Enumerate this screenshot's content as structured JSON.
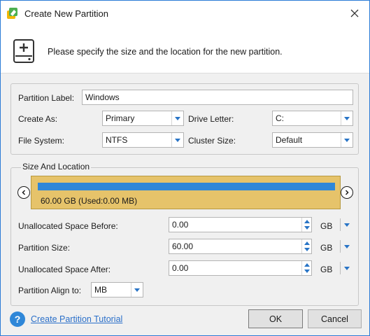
{
  "window": {
    "title": "Create New Partition"
  },
  "header": {
    "text": "Please specify the size and the location for the new partition."
  },
  "partition": {
    "label_caption": "Partition Label:",
    "label_value": "Windows",
    "create_as_caption": "Create As:",
    "create_as_value": "Primary",
    "drive_letter_caption": "Drive Letter:",
    "drive_letter_value": "C:",
    "file_system_caption": "File System:",
    "file_system_value": "NTFS",
    "cluster_size_caption": "Cluster Size:",
    "cluster_size_value": "Default"
  },
  "size_location": {
    "group_title": "Size And Location",
    "bar_text": "60.00 GB (Used:0.00 MB)",
    "before_caption": "Unallocated Space Before:",
    "before_value": "0.00",
    "before_unit": "GB",
    "size_caption": "Partition Size:",
    "size_value": "60.00",
    "size_unit": "GB",
    "after_caption": "Unallocated Space After:",
    "after_value": "0.00",
    "after_unit": "GB",
    "align_caption": "Partition Align to:",
    "align_value": "MB"
  },
  "footer": {
    "help_glyph": "?",
    "tutorial_link": "Create Partition Tutorial",
    "ok_label": "OK",
    "cancel_label": "Cancel"
  },
  "colors": {
    "accent": "#2874c6",
    "bar_fill": "#2f87d8",
    "partition_block": "#e6c36a"
  }
}
